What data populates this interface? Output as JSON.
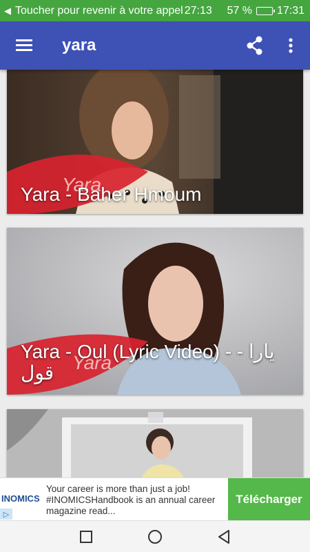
{
  "status_bar": {
    "call_text": "Toucher pour revenir à votre appel",
    "call_timer": "27:13",
    "battery_percent": "57 %",
    "battery_level": 0.57,
    "clock": "17:31"
  },
  "app_bar": {
    "title": "yara",
    "icons": [
      "menu-icon",
      "share-icon",
      "more-vert-icon"
    ],
    "color": "#3e51b5"
  },
  "videos": [
    {
      "title": "Yara - Baher Hmoum"
    },
    {
      "title": "Yara - Oul (Lyric Video) - - يارا قول"
    },
    {
      "title": ""
    }
  ],
  "ad": {
    "brand": "INOMICS",
    "text": "Your career is more than just a job! #INOMICSHandbook is an annual career magazine read...",
    "cta": "Télécharger",
    "cta_color": "#55b84a"
  },
  "nav_bar": {
    "buttons": [
      "recents-icon",
      "home-icon",
      "back-icon"
    ]
  },
  "colors": {
    "status_bar": "#45a640",
    "background": "#ececec"
  }
}
